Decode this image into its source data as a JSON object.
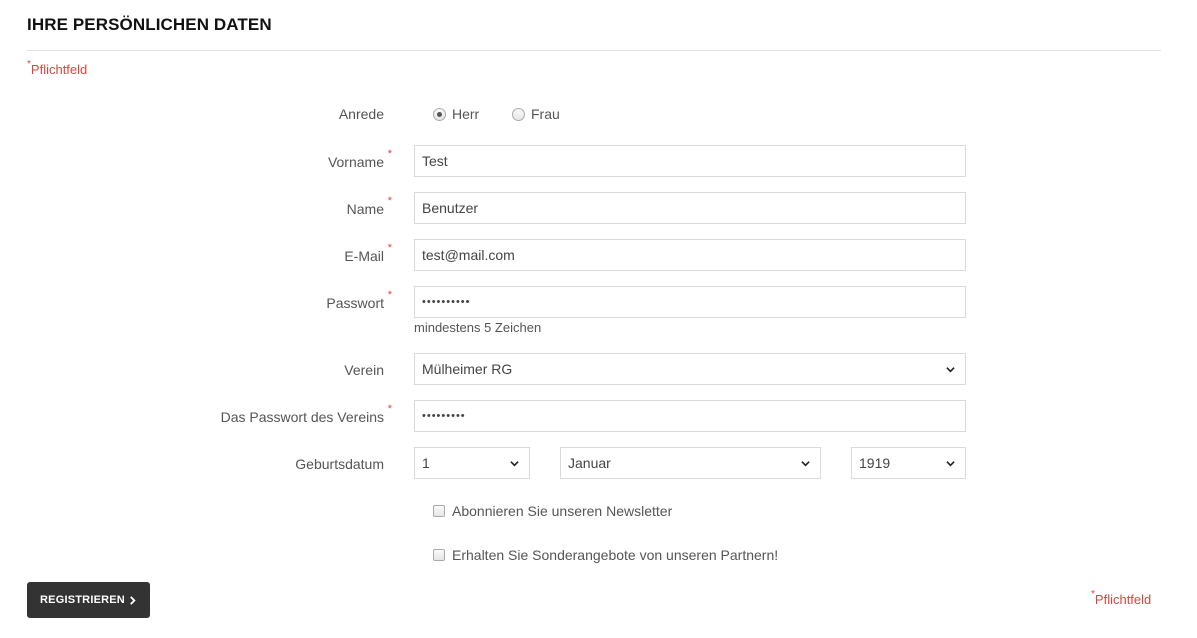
{
  "header": {
    "title": "IHRE PERSÖNLICHEN DATEN"
  },
  "required_note": {
    "star": "*",
    "text": "Pflichtfeld"
  },
  "form": {
    "salutation": {
      "label": "Anrede",
      "options": [
        {
          "label": "Herr",
          "checked": true
        },
        {
          "label": "Frau",
          "checked": false
        }
      ]
    },
    "firstname": {
      "label": "Vorname",
      "value": "Test"
    },
    "lastname": {
      "label": "Name",
      "value": "Benutzer"
    },
    "email": {
      "label": "E-Mail",
      "value": "test@mail.com"
    },
    "password": {
      "label": "Passwort",
      "value": "••••••••••",
      "hint": "mindestens 5 Zeichen"
    },
    "club": {
      "label": "Verein",
      "selected": "Mülheimer RG"
    },
    "club_password": {
      "label": "Das Passwort des Vereins",
      "value": "•••••••••"
    },
    "birthdate": {
      "label": "Geburtsdatum",
      "day": "1",
      "month": "Januar",
      "year": "1919"
    },
    "newsletter": {
      "label": "Abonnieren Sie unseren Newsletter",
      "checked": false
    },
    "partners": {
      "label": "Erhalten Sie Sonderangebote von unseren Partnern!",
      "checked": false
    }
  },
  "submit": {
    "label": "REGISTRIEREN"
  },
  "colors": {
    "required": "#e0433f",
    "button": "#333333"
  }
}
